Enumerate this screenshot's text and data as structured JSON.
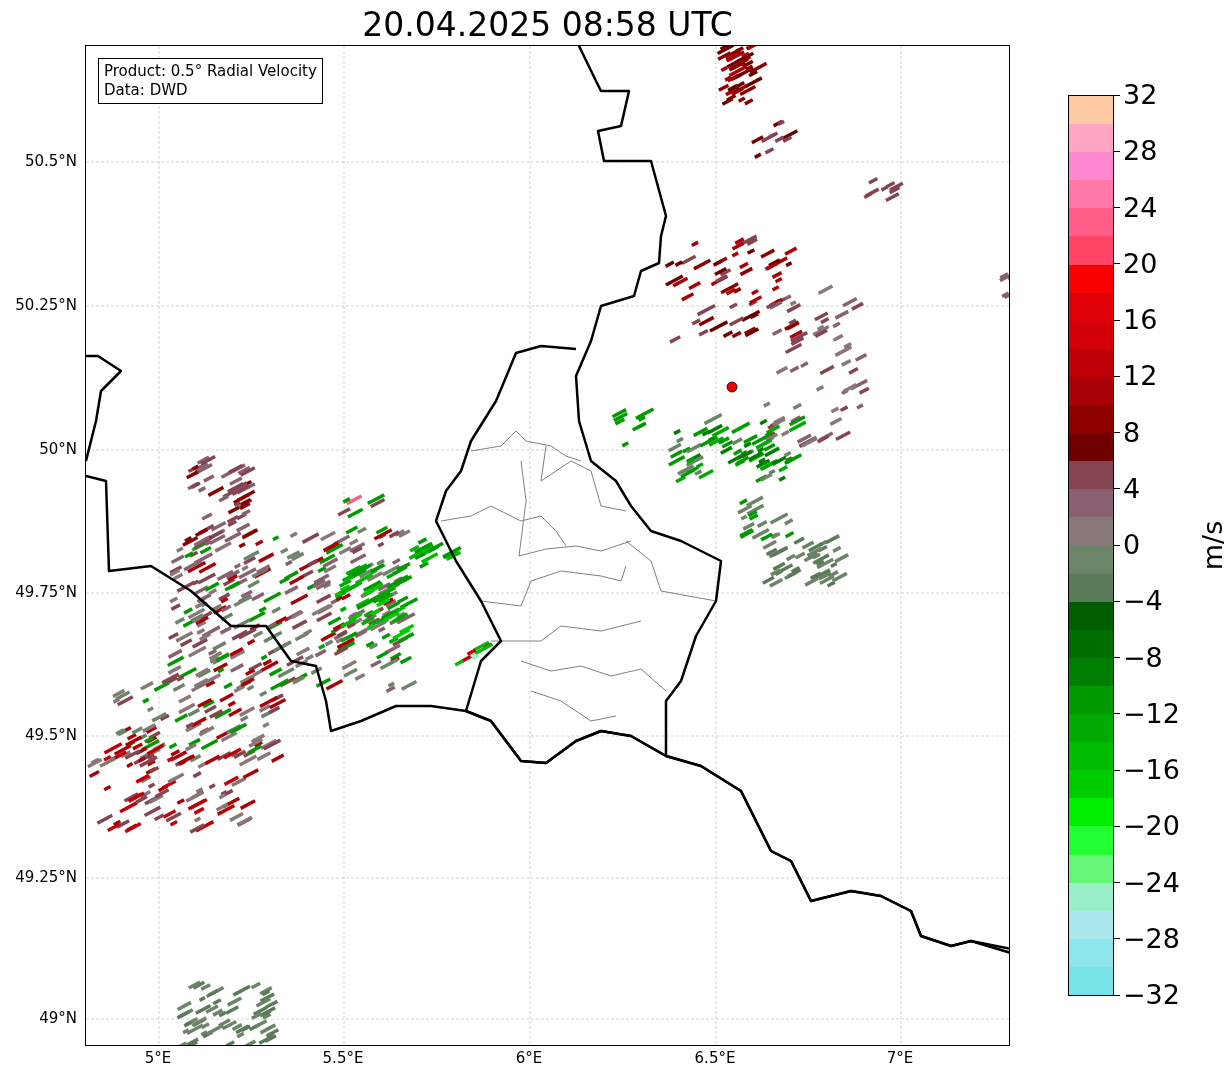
{
  "title": "20.04.2025 08:58 UTC",
  "info_box": {
    "lines": [
      "Product: 0.5° Radial Velocity",
      "Data: DWD"
    ]
  },
  "map": {
    "latitude_labels": [
      "50.5°N",
      "50.25°N",
      "50°N",
      "49.75°N",
      "49.5°N",
      "49.25°N",
      "49°N"
    ],
    "longitude_labels": [
      "5°E",
      "5.5°E",
      "6°E",
      "6.5°E",
      "7°E"
    ]
  },
  "colorbar": {
    "label": "m/s",
    "tick_labels": [
      "32",
      "28",
      "24",
      "20",
      "16",
      "12",
      "8",
      "4",
      "0",
      "−4",
      "−8",
      "−12",
      "−16",
      "−20",
      "−24",
      "−28",
      "−32"
    ],
    "segments": [
      {
        "color": "#ffcba4"
      },
      {
        "color": "#ffa6c3"
      },
      {
        "color": "#ff88d0"
      },
      {
        "color": "#ff78a8"
      },
      {
        "color": "#ff5e88"
      },
      {
        "color": "#ff4466"
      },
      {
        "color": "#f60000"
      },
      {
        "color": "#e00008"
      },
      {
        "color": "#d40008"
      },
      {
        "color": "#c00008"
      },
      {
        "color": "#aa0008"
      },
      {
        "color": "#8c0000"
      },
      {
        "color": "#6e0000"
      },
      {
        "color": "#844450"
      },
      {
        "color": "#886070"
      },
      {
        "color": "#887878"
      },
      {
        "color": "#6c8468"
      },
      {
        "color": "#5a7a58"
      },
      {
        "color": "#005e00"
      },
      {
        "color": "#006e00"
      },
      {
        "color": "#007e00"
      },
      {
        "color": "#009a00"
      },
      {
        "color": "#00aa00"
      },
      {
        "color": "#00bb00"
      },
      {
        "color": "#00cc00"
      },
      {
        "color": "#00ee00"
      },
      {
        "color": "#22ff33"
      },
      {
        "color": "#66f577"
      },
      {
        "color": "#99f0c8"
      },
      {
        "color": "#aae8ee"
      },
      {
        "color": "#8de6ec"
      },
      {
        "color": "#77e2e8"
      }
    ]
  }
}
